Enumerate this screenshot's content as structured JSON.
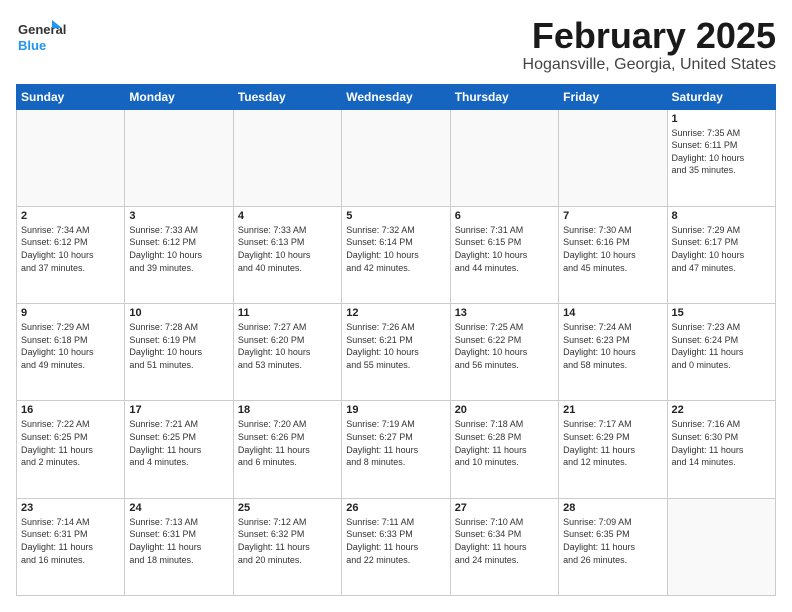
{
  "header": {
    "logo_general": "General",
    "logo_blue": "Blue",
    "title": "February 2025",
    "subtitle": "Hogansville, Georgia, United States"
  },
  "days_of_week": [
    "Sunday",
    "Monday",
    "Tuesday",
    "Wednesday",
    "Thursday",
    "Friday",
    "Saturday"
  ],
  "weeks": [
    [
      {
        "day": "",
        "info": ""
      },
      {
        "day": "",
        "info": ""
      },
      {
        "day": "",
        "info": ""
      },
      {
        "day": "",
        "info": ""
      },
      {
        "day": "",
        "info": ""
      },
      {
        "day": "",
        "info": ""
      },
      {
        "day": "1",
        "info": "Sunrise: 7:35 AM\nSunset: 6:11 PM\nDaylight: 10 hours\nand 35 minutes."
      }
    ],
    [
      {
        "day": "2",
        "info": "Sunrise: 7:34 AM\nSunset: 6:12 PM\nDaylight: 10 hours\nand 37 minutes."
      },
      {
        "day": "3",
        "info": "Sunrise: 7:33 AM\nSunset: 6:12 PM\nDaylight: 10 hours\nand 39 minutes."
      },
      {
        "day": "4",
        "info": "Sunrise: 7:33 AM\nSunset: 6:13 PM\nDaylight: 10 hours\nand 40 minutes."
      },
      {
        "day": "5",
        "info": "Sunrise: 7:32 AM\nSunset: 6:14 PM\nDaylight: 10 hours\nand 42 minutes."
      },
      {
        "day": "6",
        "info": "Sunrise: 7:31 AM\nSunset: 6:15 PM\nDaylight: 10 hours\nand 44 minutes."
      },
      {
        "day": "7",
        "info": "Sunrise: 7:30 AM\nSunset: 6:16 PM\nDaylight: 10 hours\nand 45 minutes."
      },
      {
        "day": "8",
        "info": "Sunrise: 7:29 AM\nSunset: 6:17 PM\nDaylight: 10 hours\nand 47 minutes."
      }
    ],
    [
      {
        "day": "9",
        "info": "Sunrise: 7:29 AM\nSunset: 6:18 PM\nDaylight: 10 hours\nand 49 minutes."
      },
      {
        "day": "10",
        "info": "Sunrise: 7:28 AM\nSunset: 6:19 PM\nDaylight: 10 hours\nand 51 minutes."
      },
      {
        "day": "11",
        "info": "Sunrise: 7:27 AM\nSunset: 6:20 PM\nDaylight: 10 hours\nand 53 minutes."
      },
      {
        "day": "12",
        "info": "Sunrise: 7:26 AM\nSunset: 6:21 PM\nDaylight: 10 hours\nand 55 minutes."
      },
      {
        "day": "13",
        "info": "Sunrise: 7:25 AM\nSunset: 6:22 PM\nDaylight: 10 hours\nand 56 minutes."
      },
      {
        "day": "14",
        "info": "Sunrise: 7:24 AM\nSunset: 6:23 PM\nDaylight: 10 hours\nand 58 minutes."
      },
      {
        "day": "15",
        "info": "Sunrise: 7:23 AM\nSunset: 6:24 PM\nDaylight: 11 hours\nand 0 minutes."
      }
    ],
    [
      {
        "day": "16",
        "info": "Sunrise: 7:22 AM\nSunset: 6:25 PM\nDaylight: 11 hours\nand 2 minutes."
      },
      {
        "day": "17",
        "info": "Sunrise: 7:21 AM\nSunset: 6:25 PM\nDaylight: 11 hours\nand 4 minutes."
      },
      {
        "day": "18",
        "info": "Sunrise: 7:20 AM\nSunset: 6:26 PM\nDaylight: 11 hours\nand 6 minutes."
      },
      {
        "day": "19",
        "info": "Sunrise: 7:19 AM\nSunset: 6:27 PM\nDaylight: 11 hours\nand 8 minutes."
      },
      {
        "day": "20",
        "info": "Sunrise: 7:18 AM\nSunset: 6:28 PM\nDaylight: 11 hours\nand 10 minutes."
      },
      {
        "day": "21",
        "info": "Sunrise: 7:17 AM\nSunset: 6:29 PM\nDaylight: 11 hours\nand 12 minutes."
      },
      {
        "day": "22",
        "info": "Sunrise: 7:16 AM\nSunset: 6:30 PM\nDaylight: 11 hours\nand 14 minutes."
      }
    ],
    [
      {
        "day": "23",
        "info": "Sunrise: 7:14 AM\nSunset: 6:31 PM\nDaylight: 11 hours\nand 16 minutes."
      },
      {
        "day": "24",
        "info": "Sunrise: 7:13 AM\nSunset: 6:31 PM\nDaylight: 11 hours\nand 18 minutes."
      },
      {
        "day": "25",
        "info": "Sunrise: 7:12 AM\nSunset: 6:32 PM\nDaylight: 11 hours\nand 20 minutes."
      },
      {
        "day": "26",
        "info": "Sunrise: 7:11 AM\nSunset: 6:33 PM\nDaylight: 11 hours\nand 22 minutes."
      },
      {
        "day": "27",
        "info": "Sunrise: 7:10 AM\nSunset: 6:34 PM\nDaylight: 11 hours\nand 24 minutes."
      },
      {
        "day": "28",
        "info": "Sunrise: 7:09 AM\nSunset: 6:35 PM\nDaylight: 11 hours\nand 26 minutes."
      },
      {
        "day": "",
        "info": ""
      }
    ]
  ]
}
